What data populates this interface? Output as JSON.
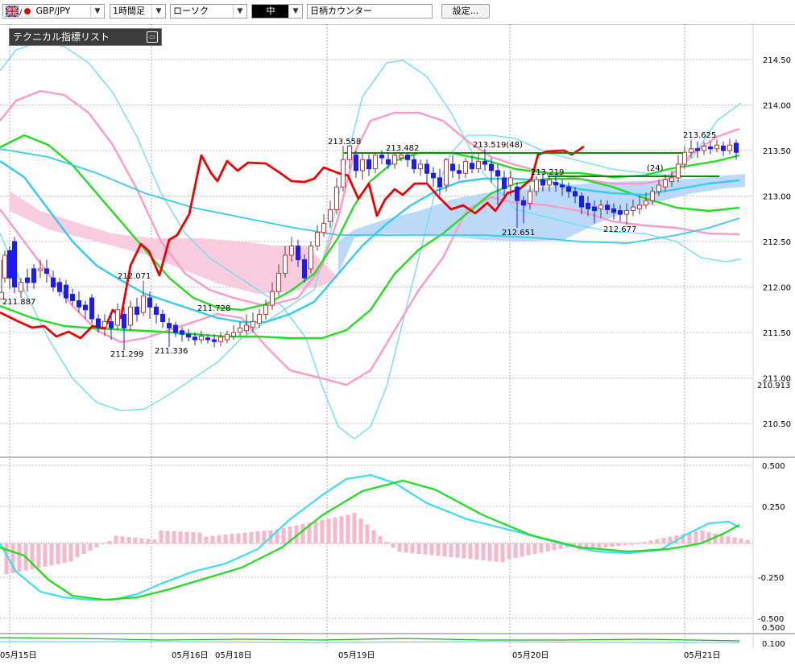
{
  "toolbar": {
    "symbol": "GBP/JPY",
    "timeframe": "1時間足",
    "chart_type": "ローソク",
    "style": "中",
    "counter": "日柄カウンター",
    "settings_label": "設定..."
  },
  "indicator_panel": {
    "title": "テクニカル指標リスト"
  },
  "colors": {
    "up_candle": "#cc3333",
    "down_candle": "#1a1aff",
    "price_line": "#ee0000",
    "bollinger_outer": "#66ddee",
    "bollinger_inner": "#ff99c8",
    "ma_green": "#22dd22",
    "ma_cyan": "#33ccee",
    "cloud": "#b8d8f8",
    "cloud_pink": "#f8c8dc",
    "macd": "#44ddee",
    "signal": "#22dd22"
  },
  "chart_data": {
    "type": "candlestick",
    "y_ticks": [
      "214.50",
      "214.00",
      "213.50",
      "213.00",
      "212.50",
      "212.00",
      "211.50",
      "211.00",
      "210.50"
    ],
    "current_price_label": "210.913",
    "annotations": [
      "211.887",
      "212.071",
      "211.299",
      "211.336",
      "211.728",
      "213.558",
      "213.482",
      "213.519(48)",
      "213.219",
      "212.651",
      "212.677",
      "213.625",
      "(24)"
    ],
    "x_labels": [
      "05月15日",
      "05月16日",
      "05月18日",
      "05月19日",
      "05月20日",
      "05月21日"
    ],
    "sub_ticks": [
      "0.500",
      "0.250",
      "-0.250",
      "-0.500"
    ],
    "sub2_ticks": [
      "0.500",
      "0.100"
    ]
  }
}
